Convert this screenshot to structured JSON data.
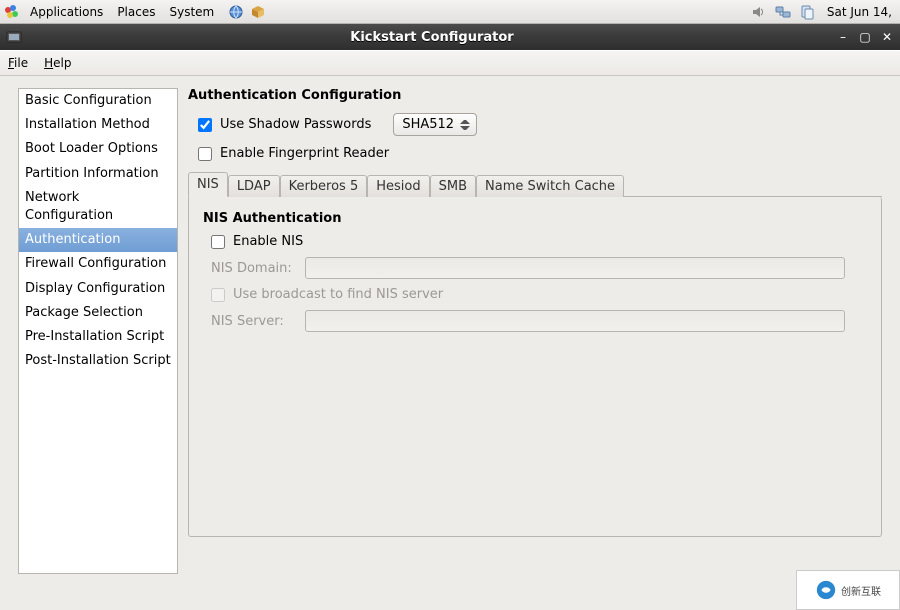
{
  "panel": {
    "applications": "Applications",
    "places": "Places",
    "system": "System",
    "clock": "Sat Jun 14,"
  },
  "window": {
    "title": "Kickstart Configurator"
  },
  "menubar": {
    "file": "ile",
    "file_accel": "F",
    "help": "elp",
    "help_accel": "H"
  },
  "sidebar": {
    "items": [
      "Basic Configuration",
      "Installation Method",
      "Boot Loader Options",
      "Partition Information",
      "Network Configuration",
      "Authentication",
      "Firewall Configuration",
      "Display Configuration",
      "Package Selection",
      "Pre-Installation Script",
      "Post-Installation Script"
    ],
    "selected_index": 5
  },
  "main": {
    "heading": "Authentication Configuration",
    "use_shadow_label": "Use Shadow Passwords",
    "use_shadow_checked": true,
    "hash_algo": "SHA512",
    "enable_fingerprint_label": "Enable Fingerprint Reader",
    "enable_fingerprint_checked": false,
    "tabs": [
      "NIS",
      "LDAP",
      "Kerberos 5",
      "Hesiod",
      "SMB",
      "Name Switch Cache"
    ],
    "active_tab": 0,
    "nis": {
      "title": "NIS Authentication",
      "enable_label": "Enable NIS",
      "enable_checked": false,
      "domain_label": "NIS Domain:",
      "domain_value": "",
      "broadcast_label": "Use broadcast to find NIS server",
      "broadcast_checked": false,
      "server_label": "NIS Server:",
      "server_value": ""
    }
  },
  "watermark": {
    "text": "创新互联"
  }
}
